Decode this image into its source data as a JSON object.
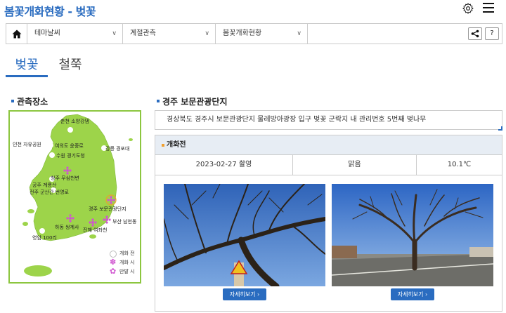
{
  "header": {
    "title": "봄꽃개화현황 - 벚꽃"
  },
  "nav": {
    "select1": "테마날씨",
    "select2": "계절관측",
    "select3": "봄꽃개화현황",
    "help_label": "?"
  },
  "tabs": [
    {
      "label": "벚꽃",
      "active": true
    },
    {
      "label": "철쭉",
      "active": false
    }
  ],
  "map_section": {
    "title": "관측장소",
    "labels": {
      "chuncheon": "춘천 소양강댐",
      "incheon": "인천 자유공원",
      "yeouido": "여의도 윤중로",
      "suwon": "수원 경기도청",
      "gangneung": "강릉 경포대",
      "cheongju": "청주 무심천변",
      "gongju": "공주 계룡산",
      "jeonju": "전주 군산간 번영로",
      "gyeongju": "경주 보문관광단지",
      "busan": "부산 남천동",
      "hadong": "하동 쌍계사",
      "jinhae": "진해 여좌천",
      "yeongam": "영암 100리"
    },
    "legend": {
      "before": "개화 전",
      "flowering": "개화 시",
      "full_bloom": "만발 시"
    }
  },
  "location": {
    "title": "경주 보문관광단지",
    "description": "경상북도 경주시 보문관광단지 물레방아광장 입구 벚꽃 군락지 내 관리번호 5번째 벚나무"
  },
  "observation": {
    "status": "개화전",
    "date": "2023-02-27 촬영",
    "weather": "맑음",
    "temperature": "10.1℃",
    "detail_label": "자세히보기 ›"
  },
  "colors": {
    "accent": "#2a6cc0",
    "map_land": "#9dd44a",
    "map_border": "#8cc63f",
    "flower": "#d055d0",
    "status_marker": "#f0a030"
  },
  "icons": {
    "settings": "gear-icon",
    "menu": "hamburger-icon",
    "home": "home-icon",
    "share": "share-icon",
    "chevron": "chevron-down-icon"
  }
}
